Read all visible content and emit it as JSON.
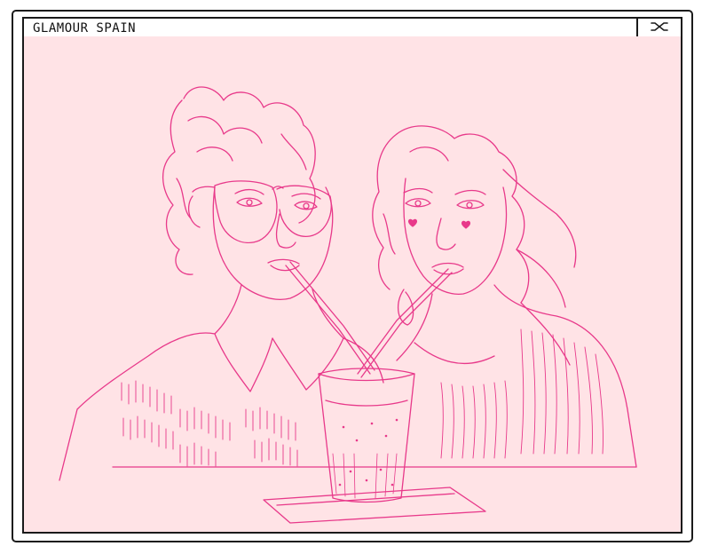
{
  "window": {
    "title": "GLAMOUR SPAIN",
    "close_icon": "close-icon"
  },
  "content": {
    "type": "illustration",
    "background_color": "#ffe3e6",
    "line_color": "#e8398a"
  }
}
